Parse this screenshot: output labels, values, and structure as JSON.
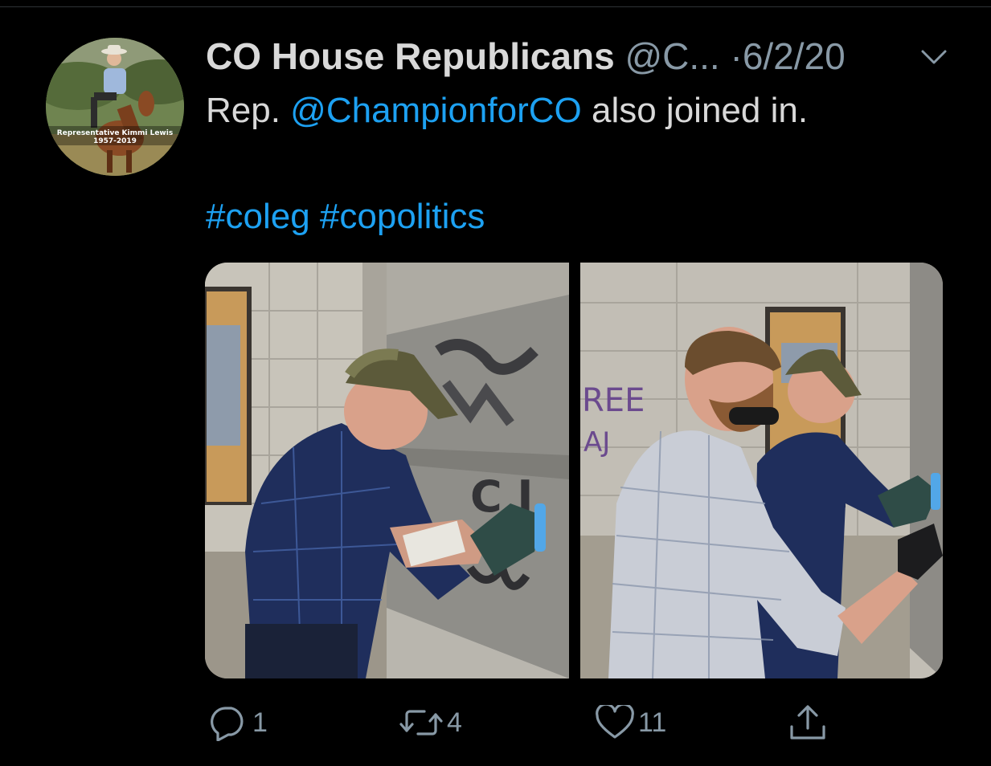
{
  "tweet": {
    "display_name": "CO House Republicans",
    "handle": "@C...",
    "separator": "·",
    "date": "6/2/20",
    "text_before": "Rep. ",
    "mention": "@ChampionforCO",
    "text_after": " also joined in.",
    "hashtags": [
      "#coleg",
      "#copolitics"
    ]
  },
  "avatar": {
    "caption_name": "Representative Kimmi Lewis",
    "caption_years": "1957-2019"
  },
  "media": {
    "left_photo": {
      "wall_graffiti": "C I"
    },
    "right_photo": {
      "wall_graffiti_line1": "REE",
      "wall_graffiti_line2": "AJ"
    }
  },
  "actions": {
    "reply_count": "1",
    "retweet_count": "4",
    "like_count": "11"
  },
  "icons": [
    "chevron-down-icon",
    "reply-icon",
    "retweet-icon",
    "like-icon",
    "share-icon"
  ],
  "colors": {
    "background": "#000000",
    "link": "#1da1f2",
    "secondary_text": "#8899a6",
    "primary_text": "#d9d9d9"
  }
}
